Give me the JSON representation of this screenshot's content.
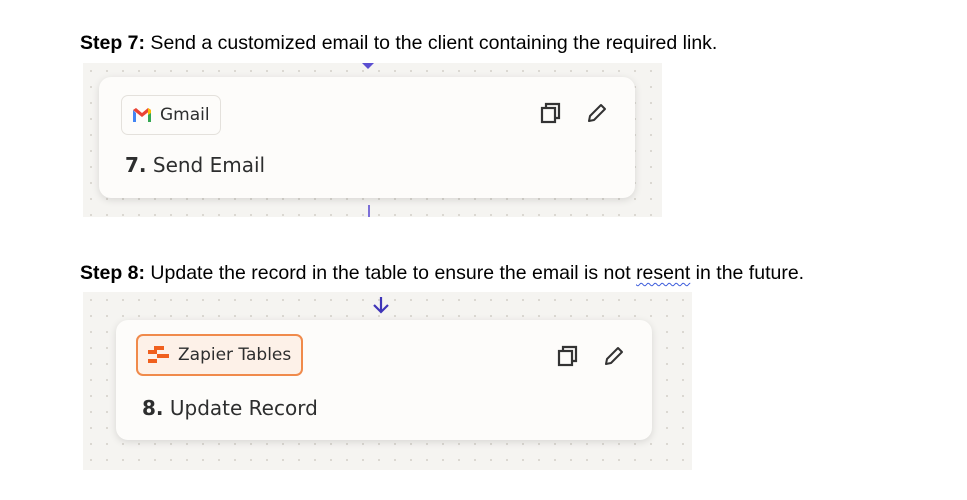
{
  "steps": [
    {
      "label": "Step 7:",
      "text": " Send a customized email to the client containing the required link.",
      "app": "Gmail",
      "num": "7.",
      "action": "Send Email"
    },
    {
      "label": "Step 8:",
      "text_before": " Update the record in the table to ensure the email is not ",
      "squiggle": "resent",
      "text_after": " in the future.",
      "app": "Zapier Tables",
      "num": "8.",
      "action": "Update Record"
    }
  ],
  "colors": {
    "accent": "#5b4fd1",
    "zapier_orange": "#ff4f00"
  }
}
